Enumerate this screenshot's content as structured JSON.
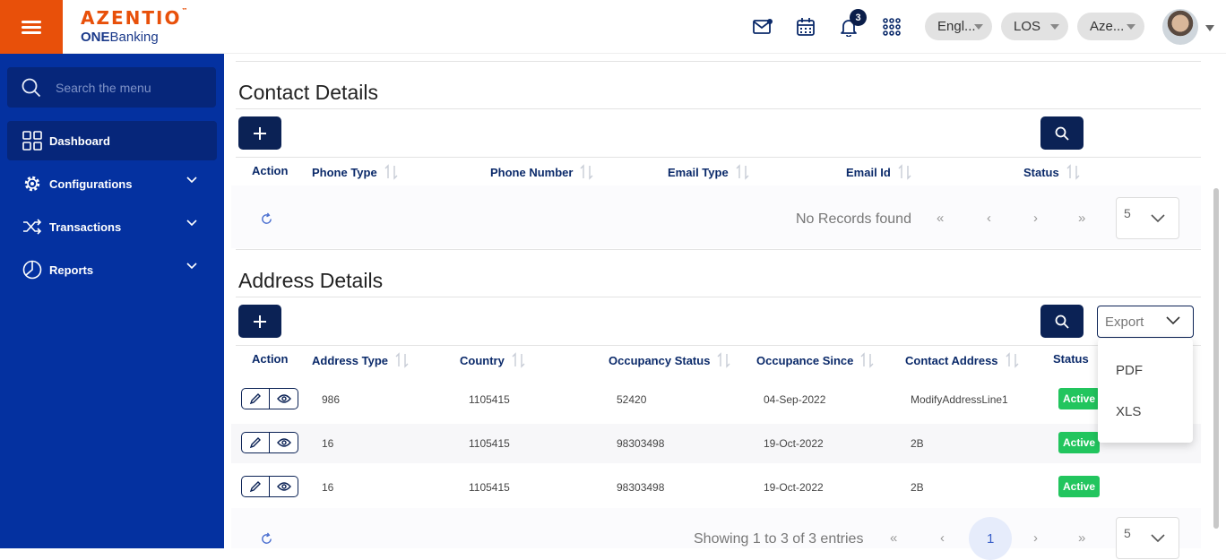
{
  "header": {
    "brand": "AZENTIO",
    "brand_mark": "™",
    "sub_bold": "ONE",
    "sub_rest": "Banking",
    "notification_count": "3",
    "language": "Engl...",
    "module": "LOS",
    "entity": "Aze..."
  },
  "sidebar": {
    "search_placeholder": "Search the menu",
    "items": [
      {
        "label": "Dashboard",
        "icon": "dashboard-grid-icon"
      },
      {
        "label": "Configurations",
        "icon": "gear-icon"
      },
      {
        "label": "Transactions",
        "icon": "shuffle-icon"
      },
      {
        "label": "Reports",
        "icon": "pie-chart-icon"
      }
    ]
  },
  "contact": {
    "title": "Contact Details",
    "columns": [
      "Action",
      "Phone Type",
      "Phone Number",
      "Email Type",
      "Email Id",
      "Status"
    ],
    "empty_text": "No Records found",
    "page_size": "5"
  },
  "address": {
    "title": "Address Details",
    "columns": [
      "Action",
      "Address Type",
      "Country",
      "Occupancy Status",
      "Occupance Since",
      "Contact Address",
      "Status"
    ],
    "rows": [
      {
        "address_type": "986",
        "country": "1105415",
        "occupancy_status": "52420",
        "since": "04-Sep-2022",
        "contact_address": "ModifyAddressLine1",
        "status": "Active"
      },
      {
        "address_type": "16",
        "country": "1105415",
        "occupancy_status": "98303498",
        "since": "19-Oct-2022",
        "contact_address": "2B",
        "status": "Active"
      },
      {
        "address_type": "16",
        "country": "1105415",
        "occupancy_status": "98303498",
        "since": "19-Oct-2022",
        "contact_address": "2B",
        "status": "Active"
      }
    ],
    "showing_text": "Showing 1 to 3 of 3 entries",
    "current_page": "1",
    "page_size": "5",
    "export_label": "Export",
    "export_options": [
      "PDF",
      "XLS"
    ]
  },
  "colors": {
    "sidebar_bg": "#0431a0",
    "brand_orange": "#e8500a",
    "button_navy": "#0b2255",
    "status_green": "#22c55e"
  }
}
